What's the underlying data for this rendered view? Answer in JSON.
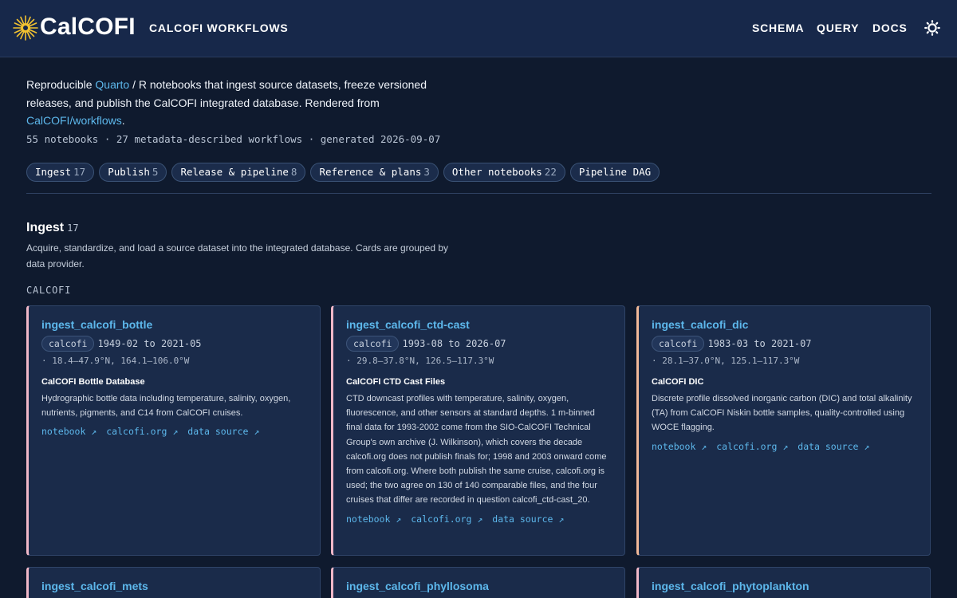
{
  "header": {
    "brand": "CalCOFI",
    "subtitle": "CALCOFI WORKFLOWS",
    "nav": [
      "SCHEMA",
      "QUERY",
      "DOCS"
    ]
  },
  "intro": {
    "text_1": "Reproducible ",
    "link_quarto": "Quarto",
    "text_2": " / R notebooks that ingest source datasets, freeze versioned releases, and publish the CalCOFI integrated database. Rendered from ",
    "link_repo": "CalCOFI/workflows",
    "text_3": ".",
    "stats": "55 notebooks · 27 metadata-described workflows · generated 2026-09-07"
  },
  "chips": [
    {
      "label": "Ingest",
      "count": "17"
    },
    {
      "label": "Publish",
      "count": "5"
    },
    {
      "label": "Release & pipeline",
      "count": "8"
    },
    {
      "label": "Reference & plans",
      "count": "3"
    },
    {
      "label": "Other notebooks",
      "count": "22"
    },
    {
      "label": "Pipeline DAG",
      "count": ""
    }
  ],
  "section": {
    "title": "Ingest",
    "count": "17",
    "desc": "Acquire, standardize, and load a source dataset into the integrated database. Cards are grouped by data provider.",
    "group": "CALCOFI"
  },
  "link_labels": {
    "notebook": "notebook ↗",
    "site": "calcofi.org ↗",
    "source": "data source ↗"
  },
  "cards": [
    {
      "title": "ingest_calcofi_bottle",
      "tag": "calcofi",
      "dates": "1949-02 to 2021-05",
      "coords": "· 18.4–47.9°N, 164.1–106.0°W",
      "name": "CalCOFI Bottle Database",
      "desc": "Hydrographic bottle data including temperature, salinity, oxygen, nutrients, pigments, and C14 from CalCOFI cruises."
    },
    {
      "title": "ingest_calcofi_ctd-cast",
      "tag": "calcofi",
      "dates": "1993-08 to 2026-07",
      "coords": "· 29.8–37.8°N, 126.5–117.3°W",
      "name": "CalCOFI CTD Cast Files",
      "desc": "CTD downcast profiles with temperature, salinity, oxygen, fluorescence, and other sensors at standard depths. 1 m-binned final data for 1993-2002 come from the SIO-CalCOFI Technical Group's own archive (J. Wilkinson), which covers the decade calcofi.org does not publish finals for; 1998 and 2003 onward come from calcofi.org. Where both publish the same cruise, calcofi.org is used; the two agree on 130 of 140 comparable files, and the four cruises that differ are recorded in question calcofi_ctd-cast_20."
    },
    {
      "title": "ingest_calcofi_dic",
      "tag": "calcofi",
      "dates": "1983-03 to 2021-07",
      "coords": "· 28.1–37.0°N, 125.1–117.3°W",
      "name": "CalCOFI DIC",
      "desc": "Discrete profile dissolved inorganic carbon (DIC) and total alkalinity (TA) from CalCOFI Niskin bottle samples, quality-controlled using WOCE flagging."
    },
    {
      "title": "ingest_calcofi_mets"
    },
    {
      "title": "ingest_calcofi_phyllosoma"
    },
    {
      "title": "ingest_calcofi_phytoplankton"
    }
  ],
  "colors": {
    "background": "#0f1a2e",
    "header": "#17284a",
    "card": "#1a2b4a",
    "accent_link": "#5db8ec",
    "card_border_pink": "#f0b8c8",
    "card_border_peach": "#f0b898",
    "logo": "#f2c230"
  },
  "icons": {
    "logo": "calcofi-sun-logo",
    "theme": "sun-brightness-icon"
  }
}
